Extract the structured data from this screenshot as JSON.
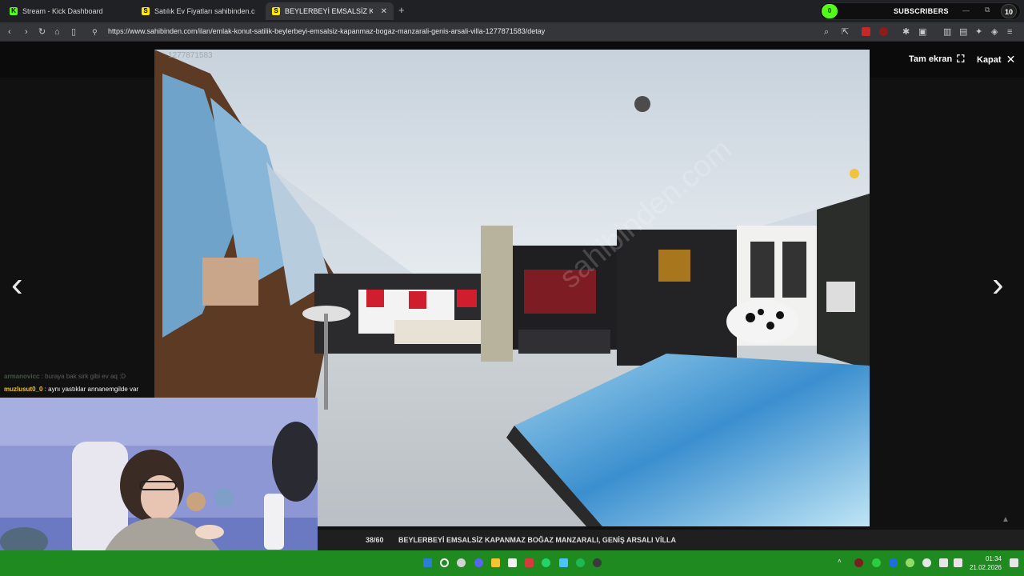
{
  "browser": {
    "tabs": [
      {
        "label": "Stream - Kick Dashboard",
        "favicon": "kick-icon",
        "active": false
      },
      {
        "label": "Satılık Ev Fiyatları sahibinden.com'da",
        "favicon": "sahibinden-icon",
        "active": false
      },
      {
        "label": "BEYLERBEYİ EMSALSİZ KAPANMA",
        "favicon": "sahibinden-icon",
        "active": true
      }
    ],
    "new_tab": "+",
    "url": "https://www.sahibinden.com/ilan/emlak-konut-satilik-beylerbeyi-emsalsiz-kapanmaz-bogaz-manzarali-genis-arsali-villa-1277871583/detay"
  },
  "subscribers_widget": {
    "left_count": "0",
    "label": "SUBSCRIBERS",
    "count": "10",
    "accent": "#53fc18"
  },
  "viewer": {
    "photo_id": "1277871583",
    "fullscreen_label": "Tam ekran",
    "close_label": "Kapat",
    "counter": "38/60",
    "title": "BEYLERBEYİ EMSALSİZ KAPANMAZ BOĞAZ MANZARALI, GENİŞ ARSALI VİLLA"
  },
  "chat": [
    {
      "user": "armanovicc",
      "message": ": buraya bak sirk gibi ev aq :D",
      "user_color": "#4f6d4f"
    },
    {
      "user": "muzlusut0_0",
      "message": ": aynı yastıklar annanemgilde var",
      "user_color": "#f0c419"
    }
  ],
  "taskbar": {
    "time": "01:34",
    "date": "21.02.2026",
    "accent": "#1f8a1f"
  }
}
